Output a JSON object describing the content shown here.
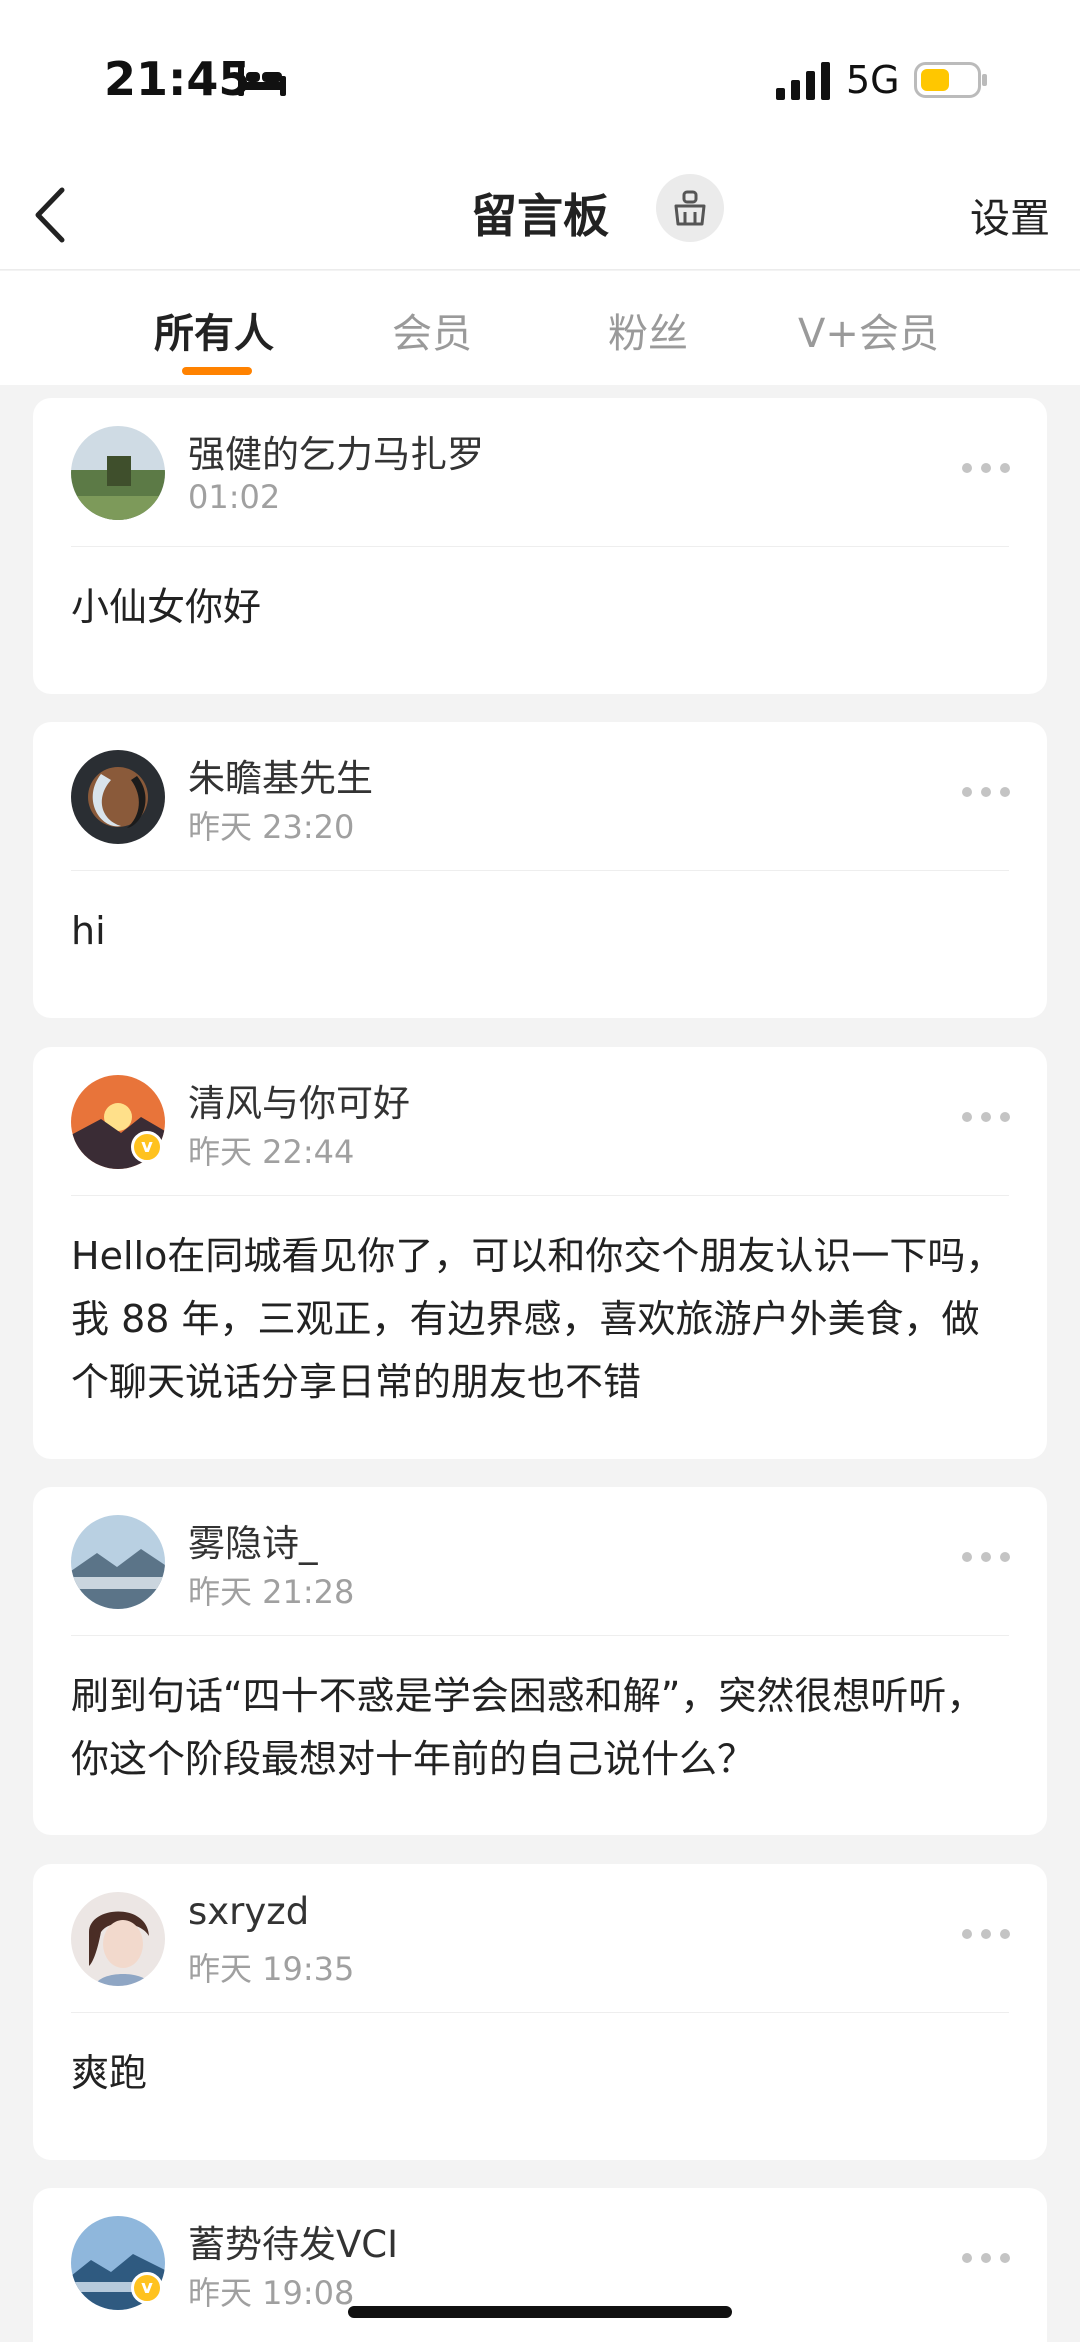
{
  "status_bar": {
    "time": "21:45",
    "network": "5G",
    "battery_color": "#ffc700"
  },
  "header": {
    "title": "留言板",
    "settings_label": "设置"
  },
  "tabs": [
    {
      "label": "所有人",
      "active": true
    },
    {
      "label": "会员",
      "active": false
    },
    {
      "label": "粉丝",
      "active": false
    },
    {
      "label": "V+会员",
      "active": false
    }
  ],
  "messages": [
    {
      "name": "强健的乞力马扎罗",
      "time": "01:02",
      "text": "小仙女你好",
      "verified": false
    },
    {
      "name": "朱瞻基先生",
      "time": "昨天 23:20",
      "text": "hi",
      "verified": false
    },
    {
      "name": "清风与你可好",
      "time": "昨天 22:44",
      "text": "Hello在同城看见你了，可以和你交个朋友认识一下吗，我 88 年，三观正，有边界感，喜欢旅游户外美食，做个聊天说话分享日常的朋友也不错",
      "verified": true
    },
    {
      "name": "雾隐诗_",
      "time": "昨天 21:28",
      "text": "刷到句话“四十不惑是学会困惑和解”，突然很想听听，你这个阶段最想对十年前的自己说什么？",
      "verified": false
    },
    {
      "name": "sxryzd",
      "time": "昨天 19:35",
      "text": "爽跑",
      "verified": false
    },
    {
      "name": "蓄势待发VCI",
      "time": "昨天 19:08",
      "text": "",
      "verified": true
    }
  ],
  "colors": {
    "accent": "#ff8200",
    "verified": "#ffc21f",
    "background": "#f3f3f3"
  }
}
